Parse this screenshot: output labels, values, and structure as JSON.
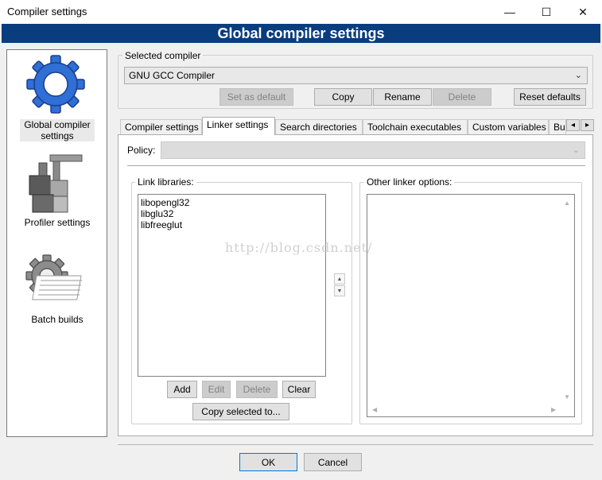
{
  "window": {
    "title": "Compiler settings",
    "minimize_glyph": "—",
    "maximize_glyph": "☐",
    "close_glyph": "✕"
  },
  "header": {
    "title": "Global compiler settings"
  },
  "sidebar": {
    "items": [
      {
        "label": "Global compiler settings",
        "icon": "gear-icon"
      },
      {
        "label": "Profiler settings",
        "icon": "profiler-icon"
      },
      {
        "label": "Batch builds",
        "icon": "batch-builds-icon"
      }
    ]
  },
  "selected_compiler": {
    "group_label": "Selected compiler",
    "value": "GNU GCC Compiler",
    "buttons": {
      "set_default": "Set as default",
      "copy": "Copy",
      "rename": "Rename",
      "delete": "Delete",
      "reset_defaults": "Reset defaults"
    }
  },
  "tabs": [
    {
      "label": "Compiler settings"
    },
    {
      "label": "Linker settings"
    },
    {
      "label": "Search directories"
    },
    {
      "label": "Toolchain executables"
    },
    {
      "label": "Custom variables"
    },
    {
      "label": "Build options"
    }
  ],
  "tab_scroll": {
    "left": "◂",
    "right": "▸"
  },
  "linker": {
    "policy_label": "Policy:",
    "link_libraries_label": "Link libraries:",
    "libraries": [
      "libopengl32",
      "libglu32",
      "libfreeglut"
    ],
    "other_options_label": "Other linker options:",
    "buttons": {
      "add": "Add",
      "edit": "Edit",
      "delete": "Delete",
      "clear": "Clear",
      "copy_selected": "Copy selected to..."
    }
  },
  "watermark": "http://blog.csdn.net/",
  "footer": {
    "ok": "OK",
    "cancel": "Cancel"
  },
  "colors": {
    "header_band": "#0a3d7e",
    "accent_blue": "#2f6fd6"
  }
}
